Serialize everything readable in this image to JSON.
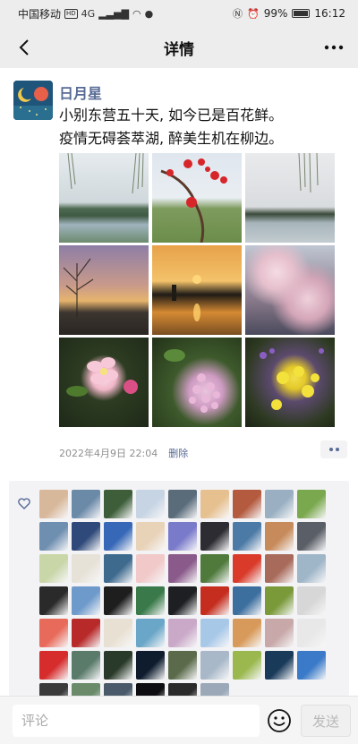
{
  "status_bar": {
    "carrier": "中国移动",
    "hd": "HD",
    "network": "4G",
    "battery": "99%",
    "time": "16:12"
  },
  "nav": {
    "title": "详情",
    "back_icon": "chevron-left-icon",
    "more_icon": "ellipsis-icon"
  },
  "post": {
    "username": "日月星",
    "text_lines": [
      "小别东营五十天, 如今已是百花鲜。",
      "疫情无碍荟萃湖, 醉美生机在柳边。"
    ],
    "photos": [
      "lake-willow",
      "red-plum-blossom",
      "lake-willow-2",
      "sunset-trees",
      "sunset-reflection",
      "cherry-blossom",
      "pink-apple-blossom",
      "lilac-cluster",
      "yellow-flowers"
    ],
    "timestamp": "2022年4月9日 22:04",
    "delete_label": "删除",
    "more_icon": "more-dots-icon"
  },
  "likes": {
    "heart_icon": "heart-icon",
    "liker_colors": [
      "#d8b89a",
      "#6b8aa8",
      "#3e5e3a",
      "#c7d4e3",
      "#5a6b7a",
      "#e6c08f",
      "#b45a3e",
      "#9ab0c2",
      "#7aa84e",
      "#6f8fb0",
      "#2f4a7a",
      "#3768b8",
      "#e8d2b8",
      "#7a7acb",
      "#2c2c32",
      "#4c7aa6",
      "#c78a5a",
      "#5a5e66",
      "#c9d6a8",
      "#e7e2d8",
      "#3e6a8e",
      "#f1c9c9",
      "#8a5a8a",
      "#4f7a3c",
      "#d93a2a",
      "#a86a5a",
      "#9fb6c8",
      "#2a2a2a",
      "#6e9acb",
      "#1e1e1e",
      "#3a7a4a",
      "#1d1f22",
      "#c52d1e",
      "#3c6e9e",
      "#7a9a3a",
      "#d7d7d7",
      "#e86a5a",
      "#b82a2a",
      "#e8e0d2",
      "#6aa6c8",
      "#c9a8c8",
      "#a8c8e8",
      "#d89a5a",
      "#c8a8a8",
      "#e8e8e8",
      "#d62c2c",
      "#5a7a6a",
      "#2a3a2a",
      "#0e1c2e",
      "#5a6a4a",
      "#a8b8c8",
      "#9ab84e",
      "#1a3a5a",
      "#3a7ac8",
      "#3a3a3a",
      "#6a8a6a",
      "#4a5a6a",
      "#0e0e12",
      "#2a2a2a",
      "#9aa8b8"
    ]
  },
  "comment_bar": {
    "placeholder": "评论",
    "emoji_icon": "emoji-smile-icon",
    "send_label": "发送"
  }
}
